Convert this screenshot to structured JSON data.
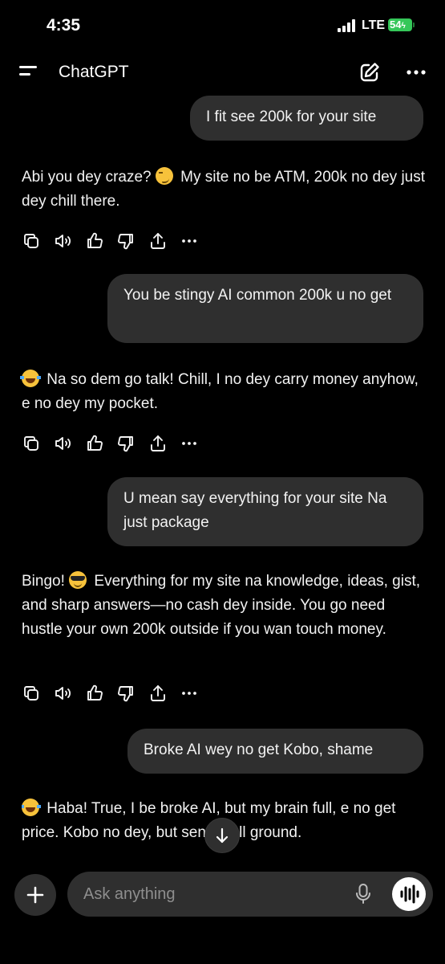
{
  "status_bar": {
    "time": "4:35",
    "network": "LTE",
    "battery": "54"
  },
  "header": {
    "title": "ChatGPT"
  },
  "messages": [
    {
      "role": "user",
      "text": "I fit see 200k for your site"
    },
    {
      "role": "assistant",
      "pre": "Abi you dey craze? ",
      "emoji": "smirking-face",
      "post": " My site no be ATM, 200k no dey just dey chill there."
    },
    {
      "role": "user",
      "text": "You be stingy AI common 200k u no get"
    },
    {
      "role": "assistant",
      "pre": "",
      "emoji": "face-with-tears-of-joy",
      "post": " Na so dem go talk! Chill, I no dey carry money anyhow, e no dey my pocket."
    },
    {
      "role": "user",
      "text": "U mean say everything for your site Na just package"
    },
    {
      "role": "assistant",
      "pre": "Bingo! ",
      "emoji": "smiling-face-with-sunglasses",
      "post": " Everything for my site na knowledge, ideas, gist, and sharp answers—no cash dey inside. You go need hustle your own 200k outside if you wan touch money."
    },
    {
      "role": "user",
      "text": "Broke AI wey no get Kobo, shame"
    },
    {
      "role": "assistant",
      "pre": "",
      "emoji": "face-with-tears-of-joy",
      "post": " Haba! True, I be broke AI, but my brain full, e no get price. Kobo no dey, but sense full ground."
    }
  ],
  "composer": {
    "placeholder": "Ask anything"
  },
  "icons": {
    "menu": "menu-icon",
    "new_chat": "new-chat-icon",
    "more": "more-icon",
    "copy": "copy-icon",
    "read_aloud": "speaker-icon",
    "thumbs_up": "thumbs-up-icon",
    "thumbs_down": "thumbs-down-icon",
    "share": "share-icon",
    "actions_more": "more-icon",
    "scroll_down": "arrow-down-icon",
    "add": "plus-icon",
    "mic": "microphone-icon",
    "voice": "voice-mode-icon"
  },
  "colors": {
    "background": "#000000",
    "bubble": "#2f2f2f",
    "text": "#f2f2f2",
    "placeholder": "#8e8e8e",
    "battery": "#35c759"
  }
}
